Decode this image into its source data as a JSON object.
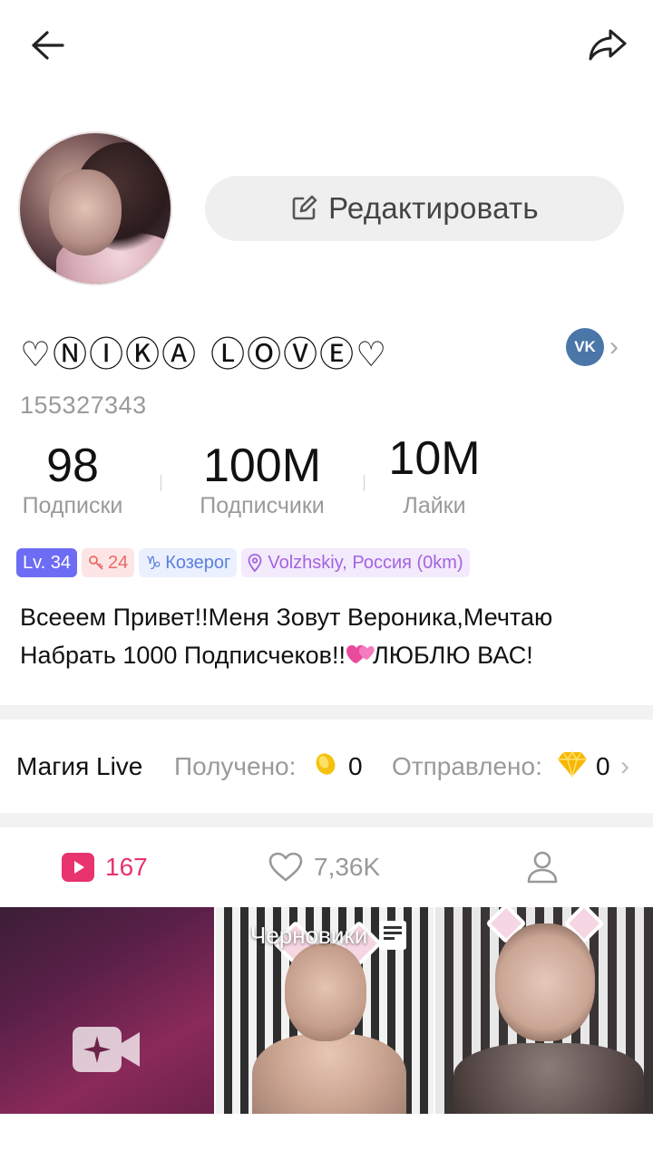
{
  "profile": {
    "username": "♡ⓃⒾⓀⒶ ⓁⓄⓋⒺ♡",
    "user_id": "155327343",
    "edit_label": "Редактировать",
    "bio_part1": "Всееем Привет!!Меня Зовут Вероника,Мечтаю Набрать 1000 Подписчеков!!",
    "bio_part2": "ЛЮБЛЮ ВАС!",
    "vk_label": "VK"
  },
  "stats": [
    {
      "value": "98",
      "label": "Подписки"
    },
    {
      "value": "100M",
      "label": "Подписчики"
    },
    {
      "value": "10M",
      "label": "Лайки"
    }
  ],
  "tags": {
    "level": "Lv. 34",
    "fragments": "24",
    "zodiac": "Козерог",
    "location": "Volzhskiy, Россия (0km)"
  },
  "magic": {
    "title": "Магия Live",
    "received_label": "Получено:",
    "received_value": "0",
    "sent_label": "Отправлено:",
    "sent_value": "0"
  },
  "tabs": {
    "videos_count": "167",
    "likes_count": "7,36K"
  },
  "grid": {
    "drafts_label": "Черновики"
  },
  "colors": {
    "accent_pink": "#e8336e",
    "level_badge": "#6c6cf5",
    "vk_blue": "#4a76a8"
  }
}
